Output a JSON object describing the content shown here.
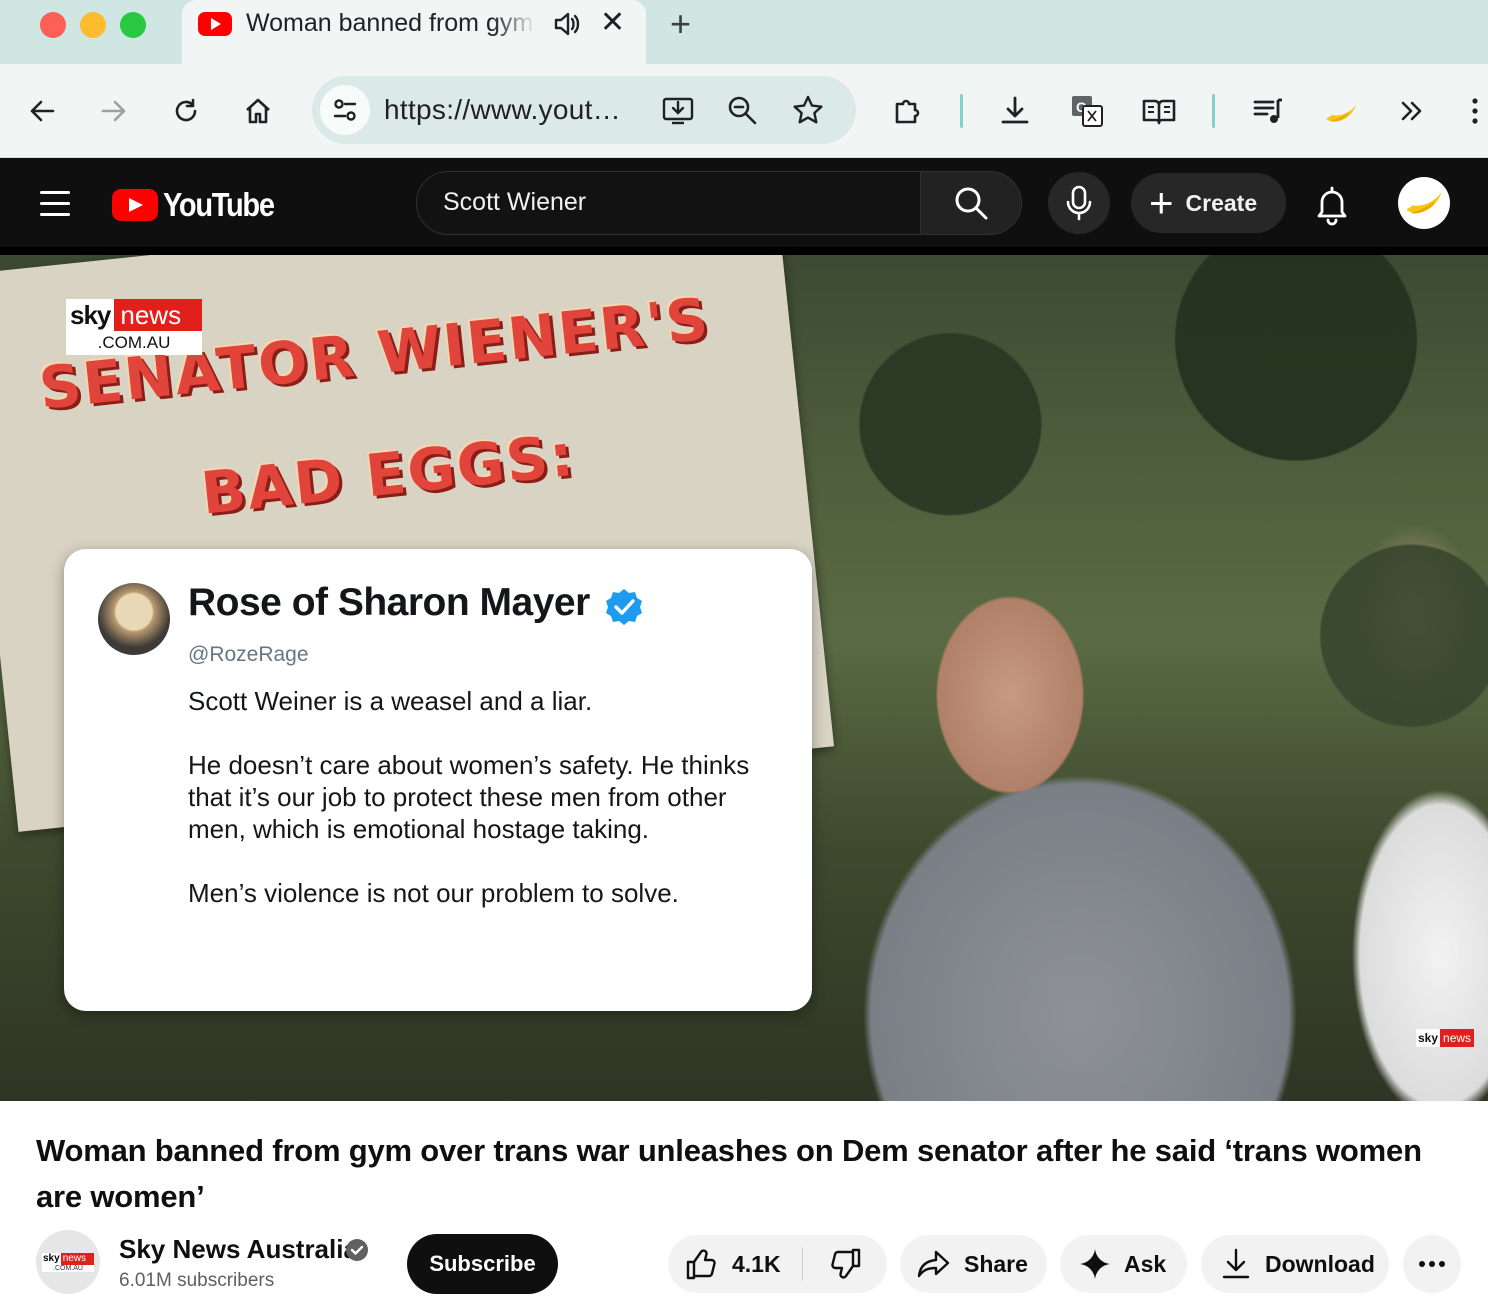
{
  "browser": {
    "tab_title": "Woman banned from gym over trans war unleashes on Dem senator after he said ‘trans women are women’ - YouTube",
    "url": "https://www.yout…",
    "new_tab_label": "+",
    "close_label": "✕"
  },
  "youtube": {
    "logo_text": "YouTube",
    "search_value": "Scott Wiener",
    "create_label": "Create"
  },
  "thumbnail": {
    "sky_logo_word": "sky",
    "sky_logo_news": "news",
    "sky_logo_domain": ".COM.AU",
    "sign_line1": "SENATOR WIENER'S",
    "sign_line2": "BAD EGGS:",
    "tweet": {
      "name": "Rose of Sharon Mayer",
      "handle": "@RozeRage",
      "paragraphs": [
        "Scott Weiner is a weasel and a liar.",
        "He doesn’t care about women’s safety. He thinks that it’s our job to protect these men from other men, which is emotional hostage taking.",
        "Men’s violence is not our problem to solve."
      ]
    },
    "bug_word": "sky",
    "bug_news": "news"
  },
  "video": {
    "title": "Woman banned from gym over trans war unleashes on Dem senator after he said ‘trans women are women’",
    "channel_name": "Sky News Australia",
    "subscribers": "6.01M subscribers",
    "subscribe_label": "Subscribe",
    "likes": "4.1K",
    "share_label": "Share",
    "ask_label": "Ask",
    "download_label": "Download"
  },
  "colors": {
    "tabbar_bg": "#cfe6e2",
    "toolbar_bg": "#f1f6f5",
    "yt_red": "#ff0000",
    "masthead_bg": "#0f0f0f",
    "verified_blue": "#1d9bf0",
    "sky_red": "#e1201c"
  }
}
